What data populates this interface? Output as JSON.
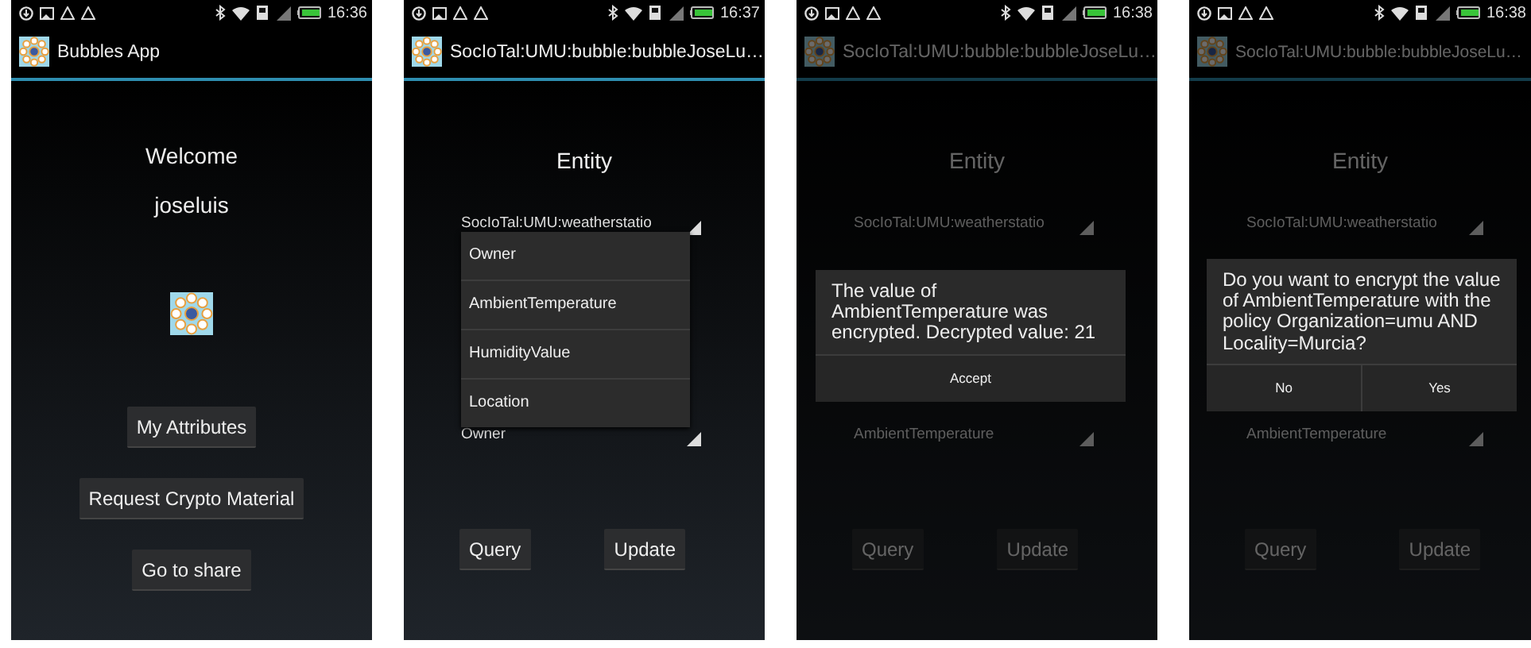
{
  "screens": [
    {
      "kind": "home",
      "status_bar": {
        "time": "16:36"
      },
      "title": "Bubbles App",
      "heading": "Welcome",
      "username": "joseluis",
      "buttons": [
        "My Attributes",
        "Request Crypto Material",
        "Go to share"
      ]
    },
    {
      "kind": "entity",
      "status_bar": {
        "time": "16:37"
      },
      "title": "SocIoTal:UMU:bubble:bubbleJoseLu…",
      "heading": "Entity",
      "spinners": [
        "SocIoTal:UMU:weatherstatio",
        "Owner"
      ],
      "buttons": [
        "Query",
        "Update"
      ],
      "dropdown": {
        "items": [
          "Owner",
          "AmbientTemperature",
          "HumidityValue",
          "Location"
        ]
      }
    },
    {
      "kind": "entity",
      "status_bar": {
        "time": "16:38"
      },
      "title": "SocIoTal:UMU:bubble:bubbleJoseLu…",
      "heading": "Entity",
      "spinners": [
        "SocIoTal:UMU:weatherstatio",
        "AmbientTemperature"
      ],
      "buttons": [
        "Query",
        "Update"
      ],
      "dialog": {
        "message": "The value of AmbientTemperature was encrypted. Decrypted value: 21",
        "buttons": [
          "Accept"
        ]
      }
    },
    {
      "kind": "entity",
      "status_bar": {
        "time": "16:38"
      },
      "title": "SocIoTal:UMU:bubble:bubbleJoseLu…",
      "heading": "Entity",
      "spinners": [
        "SocIoTal:UMU:weatherstatio",
        "AmbientTemperature"
      ],
      "buttons": [
        "Query",
        "Update"
      ],
      "dialog": {
        "message": "Do you want to encrypt the value of AmbientTemperature with the policy Organization=umu AND Locality=Murcia?",
        "buttons": [
          "No",
          "Yes"
        ]
      }
    }
  ]
}
